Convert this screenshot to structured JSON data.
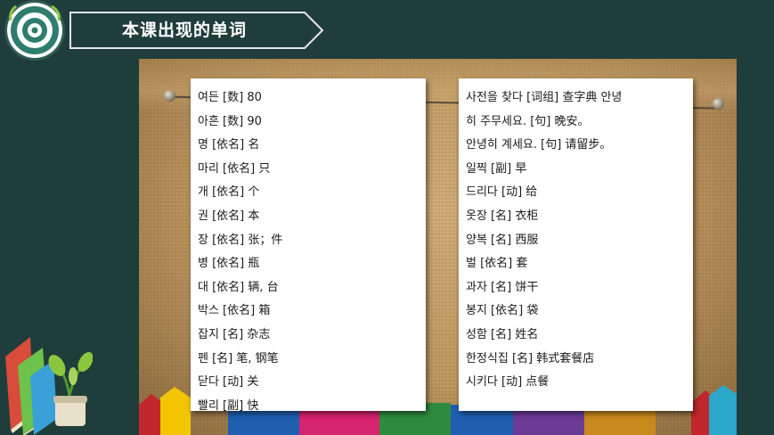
{
  "header": {
    "title": "本课出现的单词"
  },
  "left_card": {
    "lines": [
      "여든 [数] 80",
      "아흔 [数] 90",
      "명 [依名] 名",
      "마리 [依名] 只",
      "개 [依名] 个",
      "권 [依名] 本",
      "장 [依名] 张；件",
      "병 [依名] 瓶",
      "대 [依名] 辆, 台",
      "박스 [依名] 箱",
      "잡지 [名] 杂志",
      "펜 [名] 笔, 钢笔",
      "닫다 [动] 关",
      "빨리 [副] 快"
    ]
  },
  "right_card": {
    "lines": [
      "사전을 찾다 [词组] 查字典      안녕",
      "히 주무세요. [句] 晚安。",
      "안녕히 계세요. [句] 请留步。",
      "일찍 [副] 早",
      "드리다 [动] 给",
      "옷장 [名] 衣柜",
      "양복 [名] 西服",
      "벌 [依名] 套",
      "과자 [名] 饼干",
      "봉지 [依名] 袋",
      "성함 [名] 姓名",
      "한정식집 [名] 韩式套餐店",
      "시키다 [动] 点餐"
    ]
  },
  "colors": {
    "background": "#1f3d3a",
    "stripes": [
      "#c1272d",
      "#f2c500",
      "#1f5fb0",
      "#d6246e",
      "#2e8b3d",
      "#1f5fb0",
      "#6c3b96",
      "#c98a1d",
      "#2aa7c9"
    ]
  }
}
